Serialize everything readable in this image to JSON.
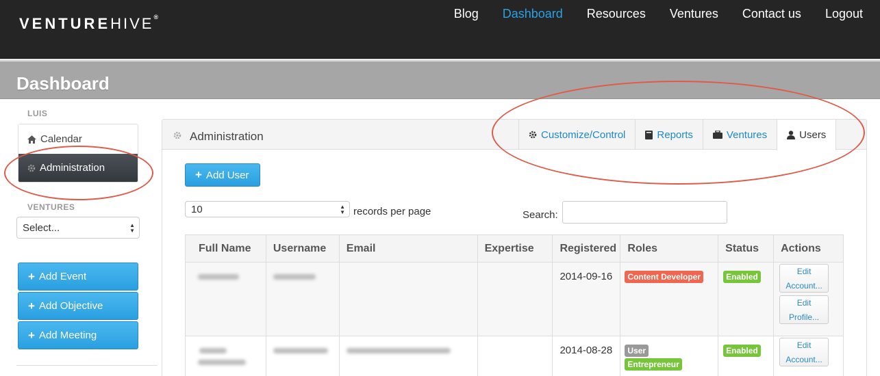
{
  "brand": {
    "bold": "VENTURE",
    "light": "HIVE",
    "mark": "®"
  },
  "nav": [
    "Blog",
    "Dashboard",
    "Resources",
    "Ventures",
    "Contact us",
    "Logout"
  ],
  "page_title": "Dashboard",
  "sidebar": {
    "user_heading": "LUIS",
    "menu": [
      "Calendar",
      "Administration"
    ],
    "ventures_heading": "VENTURES",
    "ventures_select": "Select...",
    "buttons": [
      "Add Event",
      "Add Objective",
      "Add Meeting"
    ]
  },
  "panel": {
    "title": "Administration",
    "tabs": [
      "Customize/Control",
      "Reports",
      "Ventures",
      "Users"
    ],
    "add_user": "Add User",
    "records_value": "10",
    "records_label": "records per page",
    "search_label": "Search:"
  },
  "table": {
    "headers": [
      "Full Name",
      "Username",
      "Email",
      "Expertise",
      "Registered",
      "Roles",
      "Status",
      "Actions"
    ],
    "rows": [
      {
        "registered": "2014-09-16",
        "roles": [
          "Content Developer"
        ],
        "status": "Enabled",
        "actions": [
          "Edit Account...",
          "Edit Profile..."
        ]
      },
      {
        "registered": "2014-08-28",
        "roles": [
          "User",
          "Entrepreneur"
        ],
        "status": "Enabled",
        "actions": [
          "Edit Account..."
        ]
      }
    ]
  },
  "colors": {
    "accent": "#2aa2e3",
    "annotation": "#e05a47",
    "topbar": "#252525"
  }
}
